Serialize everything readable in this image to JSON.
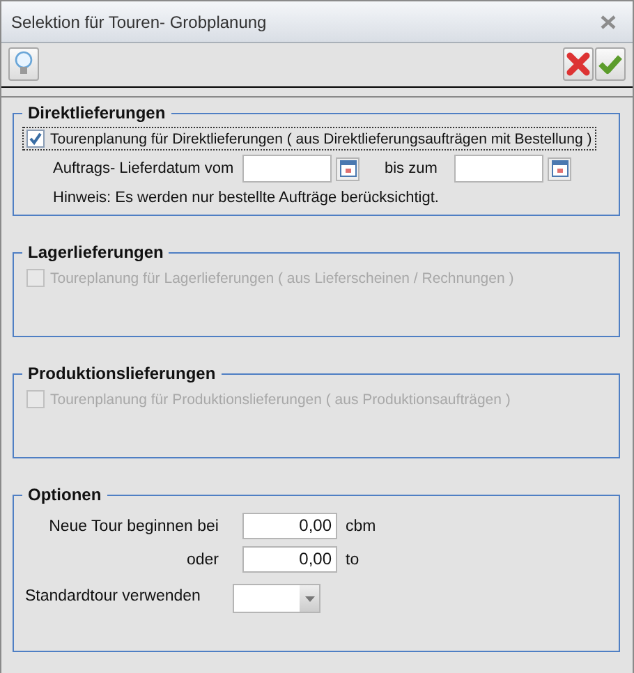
{
  "window": {
    "title": "Selektion für Touren- Grobplanung"
  },
  "sections": [
    {
      "title": "Direktlieferungen",
      "checkbox": {
        "label": "Tourenplanung für Direktlieferungen ( aus Direktlieferungsaufträgen mit Bestellung )",
        "checked": true,
        "disabled": false,
        "focused": true
      },
      "date_range": {
        "label": "Auftrags- Lieferdatum vom",
        "to_label": "bis zum"
      },
      "note": "Hinweis: Es werden nur bestellte Aufträge berücksichtigt."
    },
    {
      "title": "Lagerlieferungen",
      "checkbox": {
        "label": "Toureplanung für Lagerlieferungen ( aus Lieferscheinen / Rechnungen )",
        "checked": false,
        "disabled": true,
        "focused": false
      }
    },
    {
      "title": "Produktionslieferungen",
      "checkbox": {
        "label": "Tourenplanung für Produktionslieferungen ( aus Produktionsaufträgen )",
        "checked": false,
        "disabled": true,
        "focused": false
      }
    }
  ],
  "options": {
    "title": "Optionen",
    "rows": [
      {
        "kind": "number",
        "label": "Neue Tour beginnen bei",
        "value": "0,00",
        "unit": "cbm"
      },
      {
        "kind": "number",
        "label": "oder",
        "value": "0,00",
        "unit": "to"
      },
      {
        "kind": "dropdown",
        "label": "Standardtour verwenden"
      }
    ]
  }
}
